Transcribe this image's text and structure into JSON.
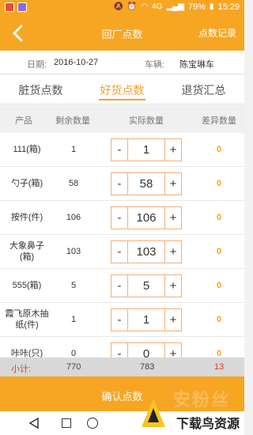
{
  "status": {
    "network": "4G",
    "battery": "79%",
    "time": "15:29"
  },
  "header": {
    "title": "回厂点数",
    "record": "点数记录"
  },
  "info": {
    "date_label": "日期:",
    "date": "2016-10-27",
    "car_label": "车辆:",
    "car": "陈宝琳车"
  },
  "tabs": [
    {
      "label": "脏货点数"
    },
    {
      "label": "好货点数"
    },
    {
      "label": "退货汇总"
    }
  ],
  "columns": {
    "product": "产品",
    "remaining": "剩余数量",
    "actual": "实际数量",
    "diff": "差异数量"
  },
  "stepper": {
    "minus": "-",
    "plus": "+"
  },
  "rows": [
    {
      "name": "111(箱)",
      "remaining": "1",
      "actual": "1",
      "diff": "0"
    },
    {
      "name": "勺子(箱)",
      "remaining": "58",
      "actual": "58",
      "diff": "0"
    },
    {
      "name": "按件(件)",
      "remaining": "106",
      "actual": "106",
      "diff": "0"
    },
    {
      "name": "大象鼻子(箱)",
      "remaining": "103",
      "actual": "103",
      "diff": "0"
    },
    {
      "name": "555(箱)",
      "remaining": "5",
      "actual": "5",
      "diff": "0"
    },
    {
      "name": "霞飞原木抽纸(件)",
      "remaining": "1",
      "actual": "1",
      "diff": "0"
    },
    {
      "name": "咔咔(只)",
      "remaining": "0",
      "actual": "0",
      "diff": "0"
    }
  ],
  "subtotal": {
    "label": "小计:",
    "remaining": "770",
    "actual": "783",
    "diff": "13"
  },
  "confirm": "确认点数",
  "watermark": {
    "text": "下载鸟资源",
    "faint": "安粉丝"
  }
}
